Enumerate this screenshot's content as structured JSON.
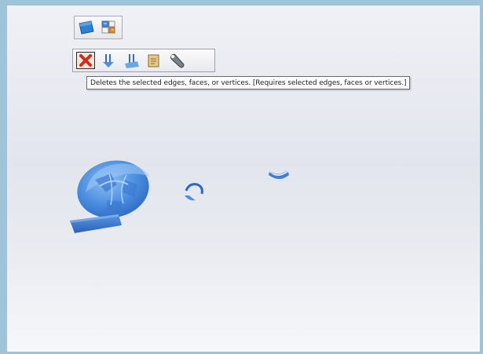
{
  "tooltip": {
    "text": "Deletes the selected edges, faces, or vertices. [Requires selected edges, faces or vertices.]"
  },
  "mini_toolbar": {
    "icons": [
      "plane-icon",
      "grid-layout-icon"
    ]
  },
  "edit_toolbar": {
    "active_tool": "delete",
    "icons": [
      "delete-icon",
      "move-down-icon",
      "move-down-alt-icon",
      "edit-notes-icon",
      "wrench-icon"
    ]
  },
  "colors": {
    "border": "#9fc3d8",
    "mesh": "#3f7fd6",
    "mesh_light": "#7fb2ee",
    "delete_red": "#d42a1d"
  }
}
